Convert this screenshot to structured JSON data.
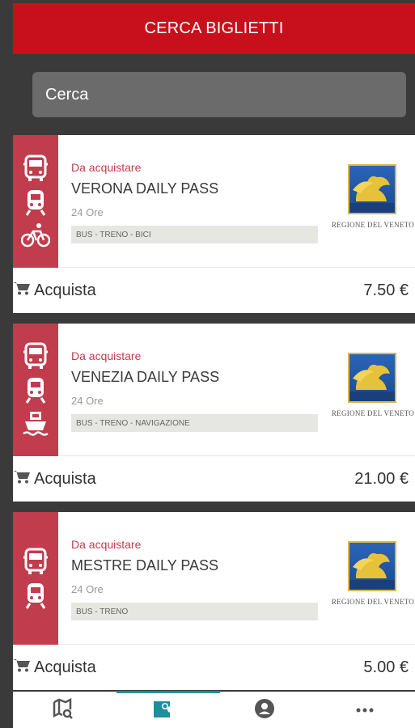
{
  "header": {
    "title": "CERCA BIGLIETTI"
  },
  "search": {
    "placeholder": "Cerca"
  },
  "tickets": [
    {
      "status": "Da acquistare",
      "title": "VERONA DAILY PASS",
      "duration": "24 Ore",
      "modes_tag": "BUS - TRENO - BICI",
      "mode_icons": [
        "bus-icon",
        "train-icon",
        "bicycle-icon"
      ],
      "issuer_caption": "REGIONE DEL VENETO",
      "buy_label": "Acquista",
      "price": "7.50 €"
    },
    {
      "status": "Da acquistare",
      "title": "VENEZIA DAILY PASS",
      "duration": "24 Ore",
      "modes_tag": "BUS - TRENO - NAVIGAZIONE",
      "mode_icons": [
        "bus-icon",
        "train-icon",
        "ferry-icon"
      ],
      "issuer_caption": "REGIONE DEL VENETO",
      "buy_label": "Acquista",
      "price": "21.00 €"
    },
    {
      "status": "Da acquistare",
      "title": "MESTRE DAILY PASS",
      "duration": "24 Ore",
      "modes_tag": "BUS - TRENO",
      "mode_icons": [
        "bus-icon",
        "train-icon"
      ],
      "issuer_caption": "REGIONE DEL VENETO",
      "buy_label": "Acquista",
      "price": "5.00 €"
    }
  ],
  "tabbar": {
    "items": [
      {
        "icon": "map-search-icon",
        "active": false
      },
      {
        "icon": "ticket-search-icon",
        "active": true
      },
      {
        "icon": "account-icon",
        "active": false
      },
      {
        "icon": "more-icon",
        "active": false
      }
    ]
  },
  "colors": {
    "header": "#c8101c",
    "strip": "#c13c4d",
    "background": "#3a3a3a",
    "tab_active": "#1f8e9e"
  }
}
